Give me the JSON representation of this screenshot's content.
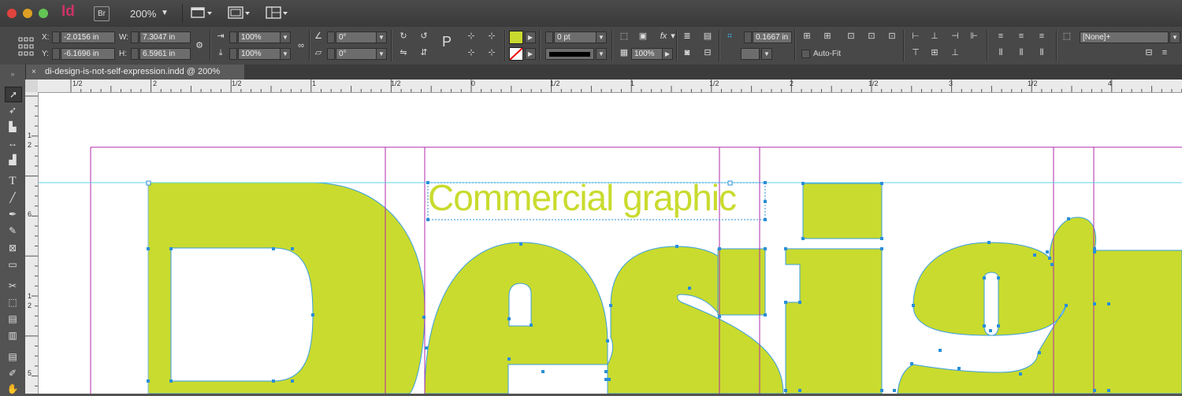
{
  "app": {
    "logo": "Id",
    "bridge": "Br",
    "zoom": "200%"
  },
  "control": {
    "x_label": "X:",
    "x_value": "-2.0156 in",
    "y_label": "Y:",
    "y_value": "-6.1696 in",
    "w_label": "W:",
    "w_value": "7.3047 in",
    "h_label": "H:",
    "h_value": "6.5961 in",
    "scale_x": "100%",
    "scale_y": "100%",
    "rotate": "0°",
    "shear": "0°",
    "stroke_weight": "0 pt",
    "opacity": "100%",
    "corner_size": "0.1667 in",
    "autofit_label": "Auto-Fit",
    "style_value": "[None]+",
    "fill_color": "#c9db2e"
  },
  "document": {
    "tab_title": "di-design-is-not-self-expression.indd @ 200%",
    "close": "×"
  },
  "ruler": {
    "h_labels": [
      "1/2",
      "2",
      "1/2",
      "1",
      "1/2",
      "0",
      "1/2",
      "1",
      "1/2",
      "2",
      "1/2",
      "3",
      "1/2",
      "4"
    ],
    "v_labels": [
      "1",
      "2",
      "6",
      "1",
      "2",
      "5"
    ]
  },
  "canvas": {
    "text_frame": "Commercial graphic",
    "headline": "Design",
    "headline_color": "#c9db2e"
  },
  "tools": [
    "selection-tool",
    "direct-selection-tool",
    "page-tool",
    "gap-tool",
    "content-collector-tool",
    "type-tool",
    "line-tool",
    "pen-tool",
    "pencil-tool",
    "rectangle-frame-tool",
    "rectangle-tool",
    "scissors-tool",
    "free-transform-tool",
    "gradient-swatch-tool",
    "gradient-feather-tool",
    "note-tool",
    "eyedropper-tool",
    "hand-tool"
  ]
}
